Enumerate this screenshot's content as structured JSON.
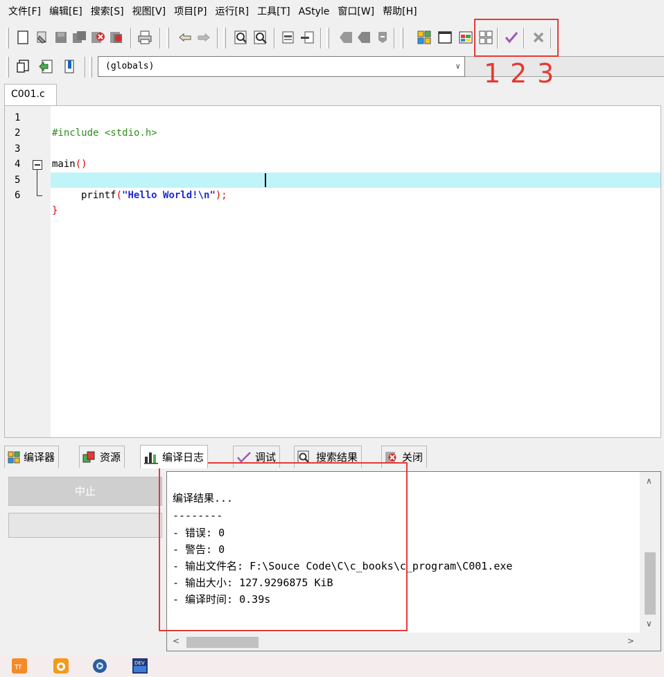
{
  "menu": [
    "文件[F]",
    "编辑[E]",
    "搜索[S]",
    "视图[V]",
    "项目[P]",
    "运行[R]",
    "工具[T]",
    "AStyle",
    "窗口[W]",
    "帮助[H]"
  ],
  "toolbar": {
    "scope_combo": "(globals)",
    "icons": [
      "new-file-icon",
      "open-file-icon",
      "save-icon",
      "save-all-icon",
      "close-file-icon",
      "close-all-icon",
      "print-icon",
      "undo-icon",
      "redo-icon",
      "find-icon",
      "replace-icon",
      "indent-icon",
      "unindent-icon",
      "toggle-bookmark-icon",
      "goto-bookmark-icon",
      "comment-icon",
      "compile-icon",
      "run-icon",
      "compile-run-icon",
      "rebuild-icon",
      "debug-check-icon",
      "stop-icon",
      "new-class-icon",
      "insert-icon",
      "bookmark-icon"
    ]
  },
  "annotation": {
    "labels": [
      "1",
      "2",
      "3"
    ],
    "color": "#e53935"
  },
  "editor": {
    "tab": "C001.c",
    "lines": [
      {
        "num": "1",
        "text": "#include <stdio.h>"
      },
      {
        "num": "2",
        "text": ""
      },
      {
        "num": "3",
        "text": "main"
      },
      {
        "num": "4",
        "text": "{"
      },
      {
        "num": "5",
        "text": "printf"
      },
      {
        "num": "6",
        "text": "}"
      }
    ],
    "paren_pair": "()",
    "open_paren": "(",
    "string": "\"Hello World!\\n\"",
    "close_semi": ");",
    "current_line_color": "#bff4f8"
  },
  "panel": {
    "tabs": [
      {
        "label": "编译器",
        "icon": "compiler-grid-icon"
      },
      {
        "label": "资源",
        "icon": "resources-icon"
      },
      {
        "label": "编译日志",
        "icon": "bar-chart-icon"
      },
      {
        "label": "调试",
        "icon": "checkmark-icon"
      },
      {
        "label": "搜索结果",
        "icon": "search-results-icon"
      },
      {
        "label": "关闭",
        "icon": "close-panel-icon"
      }
    ],
    "active_tab": "编译日志",
    "stop_button": "中止",
    "log": [
      "编译结果...",
      "--------",
      "- 错误: 0",
      "- 警告: 0",
      "- 输出文件名: F:\\Souce Code\\C\\c_books\\c_program\\C001.exe",
      "- 输出大小: 127.9296875 KiB",
      "- 编译时间: 0.39s"
    ]
  },
  "taskbar": {
    "icons": [
      "calculator-app-icon",
      "uc-browser-icon",
      "media-player-icon",
      "dev-cpp-icon"
    ]
  }
}
